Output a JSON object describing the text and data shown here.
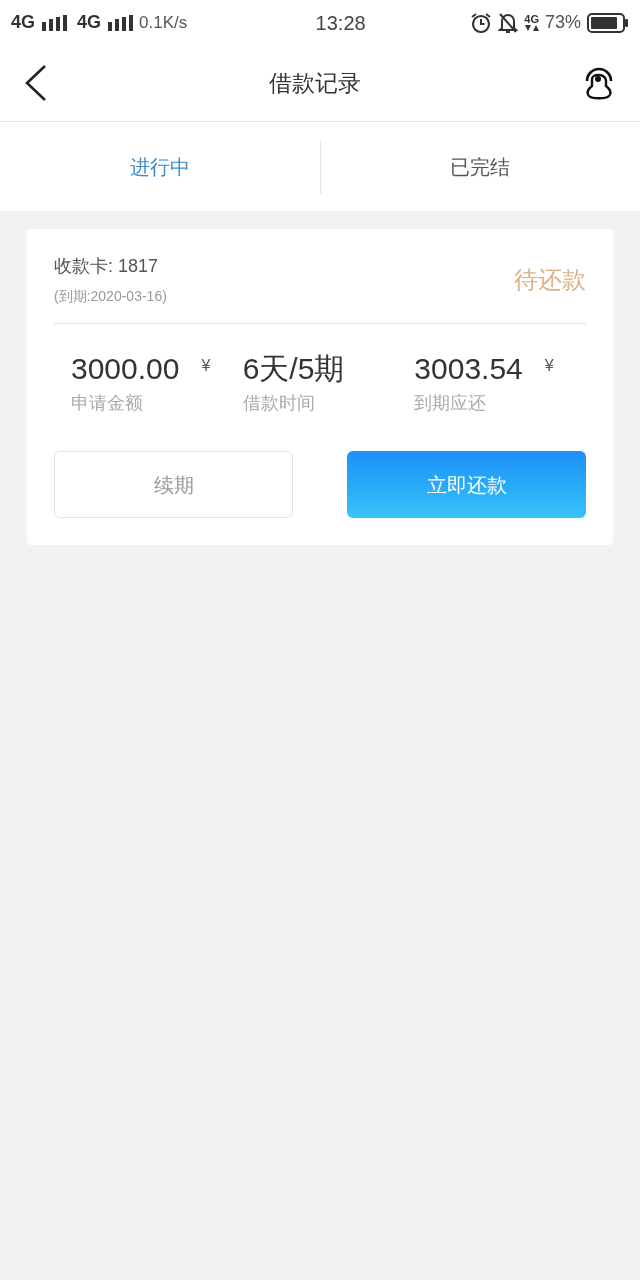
{
  "status_bar": {
    "network_1": "4G",
    "network_2": "4G",
    "speed": "0.1K/s",
    "time": "13:28",
    "data_network": "4G",
    "battery": "73%"
  },
  "header": {
    "title": "借款记录"
  },
  "tabs": [
    {
      "label": "进行中",
      "selected": true
    },
    {
      "label": "已完结",
      "selected": false
    }
  ],
  "loan_card": {
    "card": "收款卡: 1817",
    "due": "(到期:2020-03-16)",
    "status": "待还款",
    "stats": [
      {
        "value": "3000.00",
        "unit": "¥",
        "label": "申请金额"
      },
      {
        "value": "6天/5期",
        "label": "借款时间"
      },
      {
        "value": "3003.54",
        "unit": "¥",
        "label": "到期应还"
      }
    ],
    "buttons": [
      {
        "label": "续期",
        "kind": "outline"
      },
      {
        "label": "立即还款",
        "kind": "primary"
      }
    ]
  }
}
